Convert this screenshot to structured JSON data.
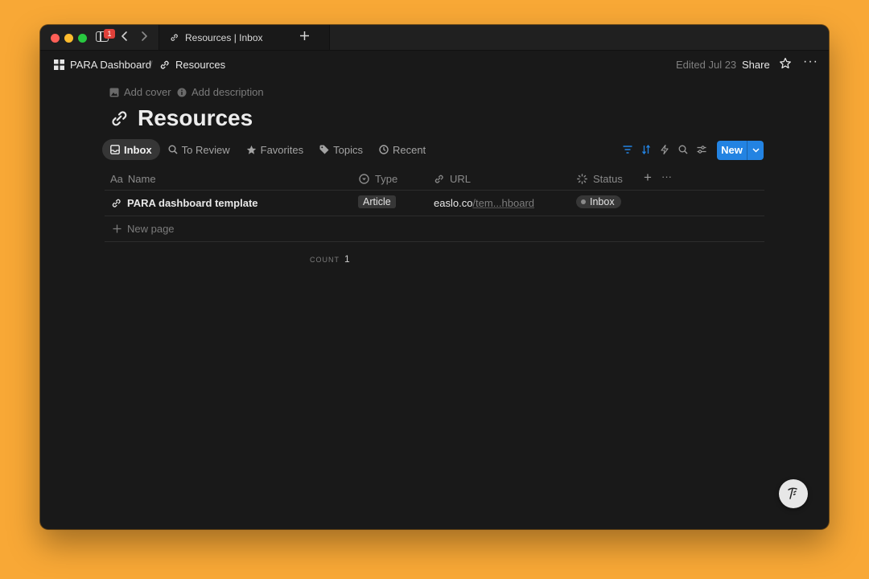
{
  "window": {
    "tab_title": "Resources | Inbox",
    "notification_count": "1"
  },
  "topbar": {
    "breadcrumb_root": "PARA Dashboard",
    "breadcrumb_separator": "/",
    "breadcrumb_current": "Resources",
    "edited": "Edited Jul 23",
    "share": "Share",
    "more": "···"
  },
  "page": {
    "add_cover": "Add cover",
    "add_description": "Add description",
    "title": "Resources"
  },
  "views": [
    {
      "label": "Inbox",
      "icon": "inbox-icon",
      "active": true
    },
    {
      "label": "To Review",
      "icon": "search-icon",
      "active": false
    },
    {
      "label": "Favorites",
      "icon": "star-icon",
      "active": false
    },
    {
      "label": "Topics",
      "icon": "tag-icon",
      "active": false
    },
    {
      "label": "Recent",
      "icon": "clock-icon",
      "active": false
    }
  ],
  "toolbar": {
    "new_label": "New",
    "accent": "#2383e2"
  },
  "table": {
    "columns": [
      {
        "label": "Name",
        "prefix": "Aa"
      },
      {
        "label": "Type",
        "icon": "select-icon"
      },
      {
        "label": "URL",
        "icon": "link-icon"
      },
      {
        "label": "Status",
        "icon": "status-icon"
      }
    ],
    "rows": [
      {
        "name": "PARA dashboard template",
        "type": "Article",
        "url_domain": "easlo.co",
        "url_path": "/tem...hboard",
        "status": "Inbox"
      }
    ],
    "new_page": "New page",
    "count_label": "COUNT",
    "count_value": "1",
    "add_column": "+",
    "more_columns": "···"
  }
}
